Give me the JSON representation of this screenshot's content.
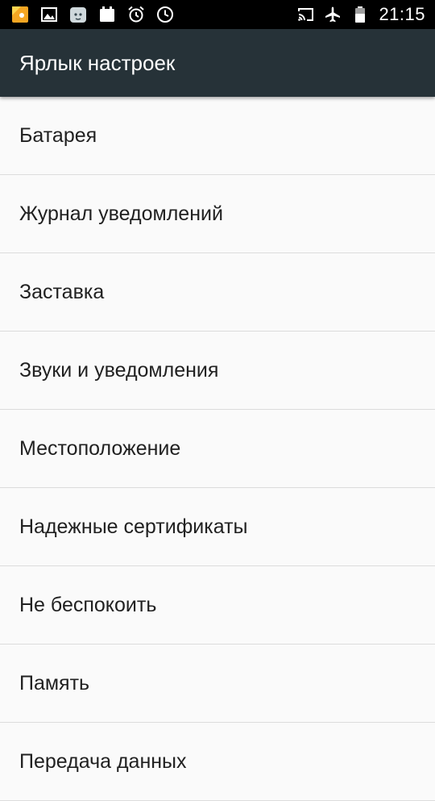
{
  "status_bar": {
    "time": "21:15",
    "left_icons": [
      "notification-app-icon",
      "image-icon",
      "cat-app-icon",
      "calendar-icon",
      "alarm-icon",
      "clock-icon"
    ],
    "right_icons": [
      "cast-icon",
      "airplane-mode-icon",
      "battery-icon"
    ]
  },
  "app_bar": {
    "title": "Ярлык настроек",
    "color": "#263238"
  },
  "settings": {
    "items": [
      {
        "label": "Батарея"
      },
      {
        "label": "Журнал уведомлений"
      },
      {
        "label": "Заставка"
      },
      {
        "label": "Звуки и уведомления"
      },
      {
        "label": "Местоположение"
      },
      {
        "label": "Надежные сертификаты"
      },
      {
        "label": "Не беспокоить"
      },
      {
        "label": "Память"
      },
      {
        "label": "Передача данных"
      }
    ]
  }
}
